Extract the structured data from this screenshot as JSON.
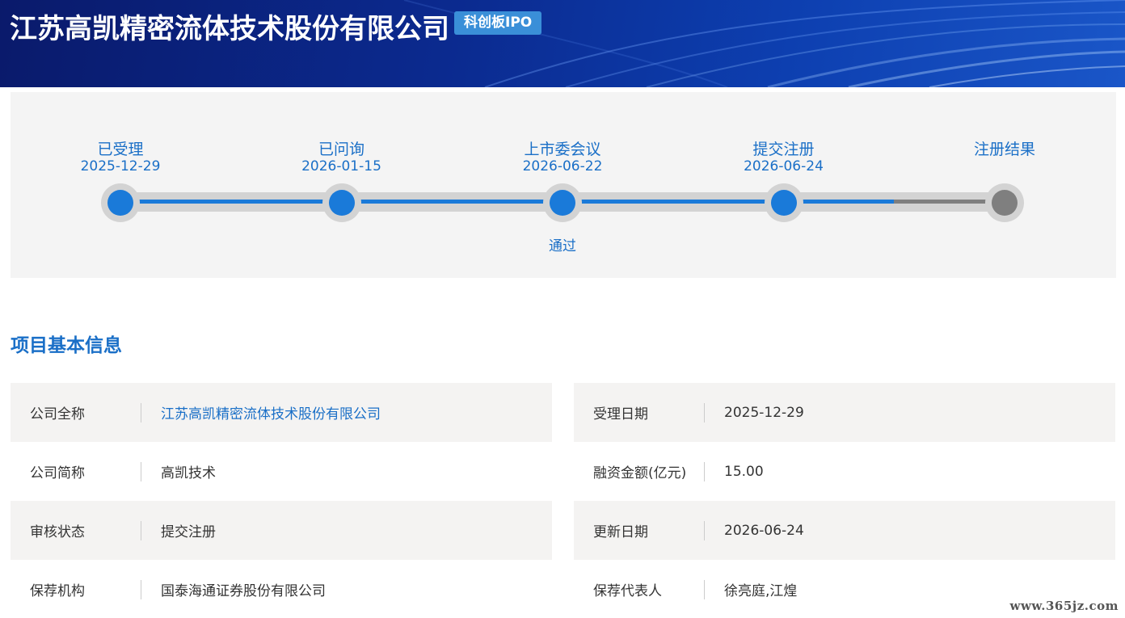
{
  "header": {
    "company_name": "江苏高凯精密流体技术股份有限公司",
    "board_badge": "科创板IPO"
  },
  "progress": {
    "steps": [
      {
        "label": "已受理",
        "date": "2025-12-29",
        "done": true,
        "result": ""
      },
      {
        "label": "已问询",
        "date": "2026-01-15",
        "done": true,
        "result": ""
      },
      {
        "label": "上市委会议",
        "date": "2026-06-22",
        "done": true,
        "result": "通过"
      },
      {
        "label": "提交注册",
        "date": "2026-06-24",
        "done": true,
        "result": ""
      },
      {
        "label": "注册结果",
        "date": "",
        "done": false,
        "result": ""
      }
    ],
    "colors": {
      "done": "#1a7ad9",
      "pending": "#7f7f7f",
      "track": "#d3d3d3"
    }
  },
  "section": {
    "title": "项目基本信息"
  },
  "info": {
    "left": [
      {
        "label": "公司全称",
        "value": "江苏高凯精密流体技术股份有限公司",
        "link": true
      },
      {
        "label": "公司简称",
        "value": "高凯技术",
        "link": false
      },
      {
        "label": "审核状态",
        "value": "提交注册",
        "link": false
      },
      {
        "label": "保荐机构",
        "value": "国泰海通证券股份有限公司",
        "link": false
      }
    ],
    "right": [
      {
        "label": "受理日期",
        "value": "2025-12-29"
      },
      {
        "label": "融资金额(亿元)",
        "value": "15.00"
      },
      {
        "label": "更新日期",
        "value": "2026-06-24"
      },
      {
        "label": "保荐代表人",
        "value": "徐亮庭,江煌"
      }
    ]
  },
  "watermark": "www.365jz.com"
}
